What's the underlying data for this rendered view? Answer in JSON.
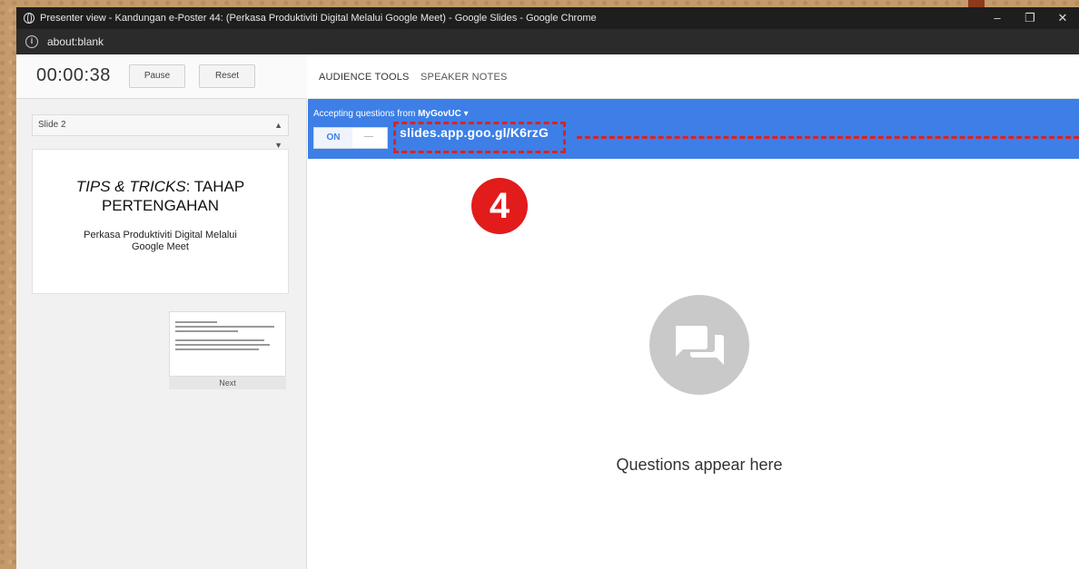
{
  "window": {
    "title": "Presenter view - Kandungan e-Poster 44: (Perkasa Produktiviti Digital Melalui Google Meet) - Google Slides - Google Chrome",
    "address": "about:blank",
    "controls": {
      "minimize": "–",
      "restore": "❐",
      "close": "✕"
    }
  },
  "presenter": {
    "timer": "00:00:38",
    "pause_label": "Pause",
    "reset_label": "Reset",
    "slide_select": "Slide 2",
    "current_slide": {
      "title_italic": "TIPS & TRICKS",
      "title_rest": ": TAHAP PERTENGAHAN",
      "subtitle": "Perkasa Produktiviti Digital Melalui Google Meet"
    },
    "next_label": "Next"
  },
  "tabs": {
    "audience": "AUDIENCE TOOLS",
    "notes": "SPEAKER NOTES"
  },
  "audience": {
    "accepting_prefix": "Accepting questions from",
    "org": "MyGovUC",
    "dropdown_icon": "▾",
    "toggle_on": "ON",
    "toggle_off": "—",
    "link": "slides.app.goo.gl/K6rzG",
    "badge": "4",
    "empty_text": "Questions appear here"
  },
  "colors": {
    "accent_blue": "#3d7fe6",
    "annotation_red": "#d22222"
  }
}
